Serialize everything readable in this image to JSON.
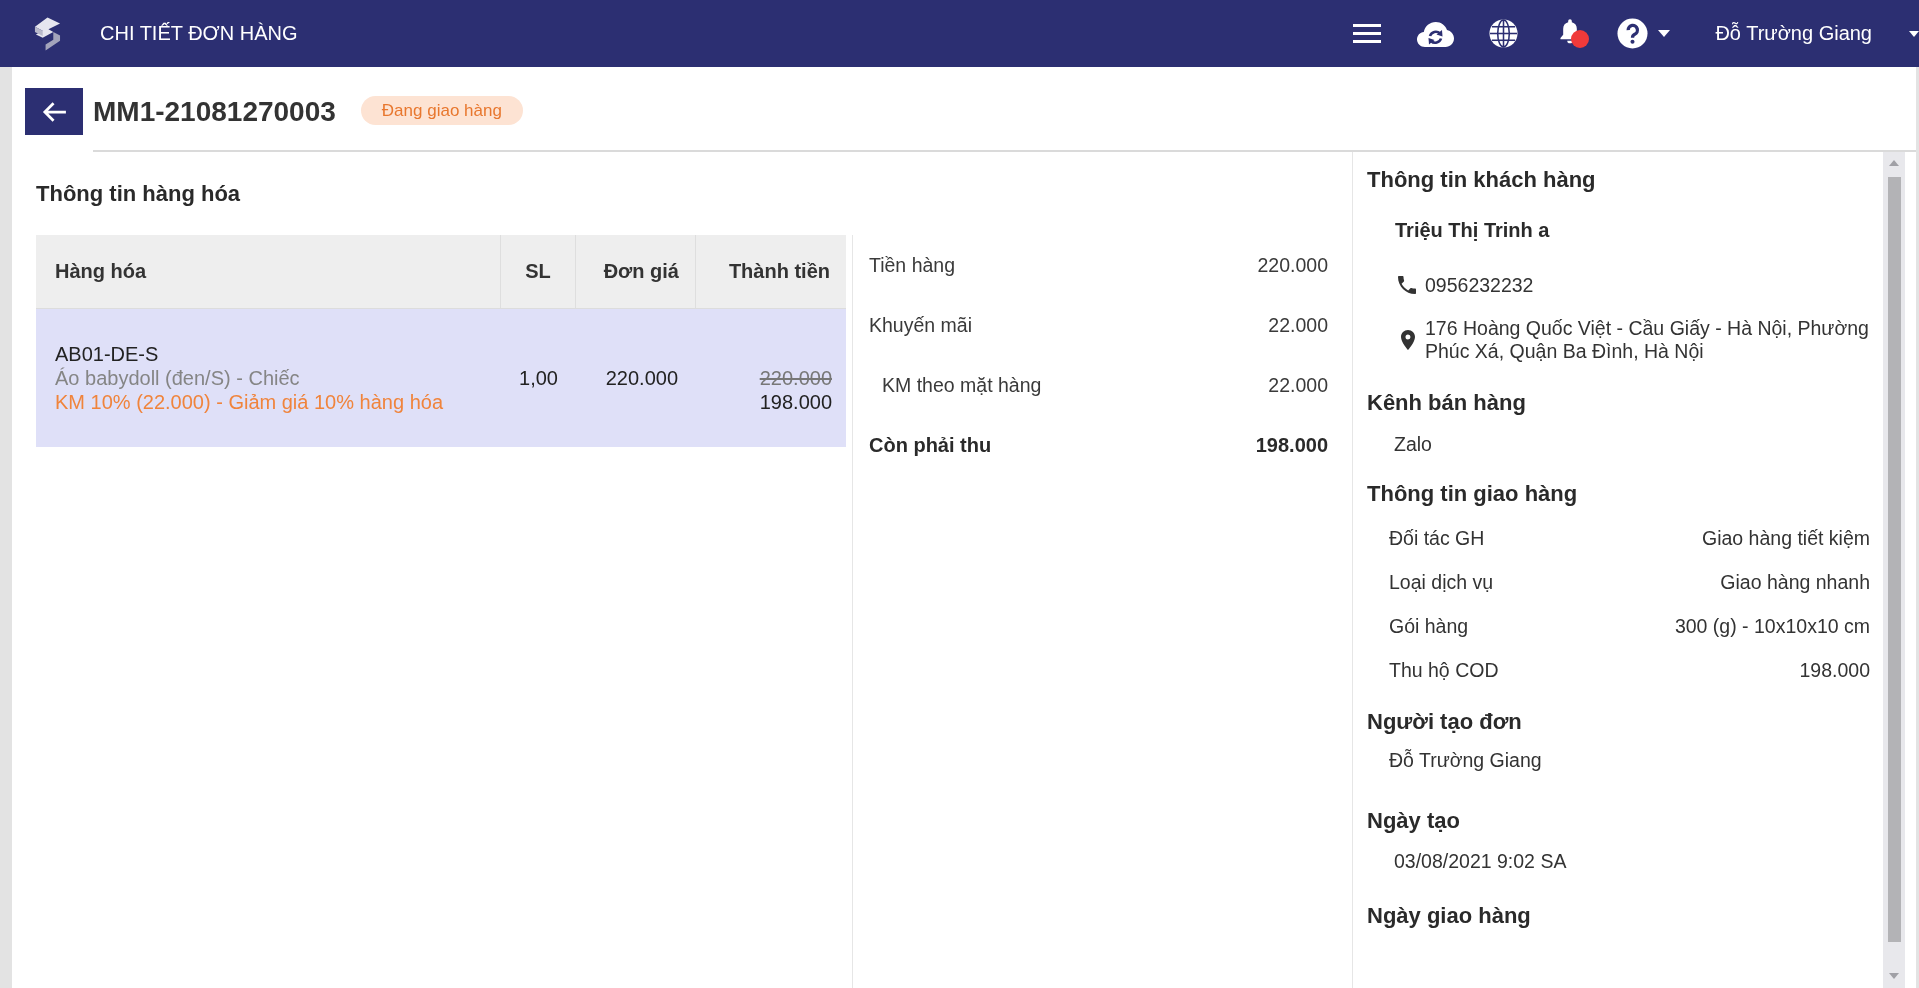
{
  "top_bar": {
    "title": "CHI TIẾT ĐƠN HÀNG",
    "notifications": {
      "unread": true
    },
    "user_name": "Đỗ Trường Giang"
  },
  "order": {
    "code": "MM1-21081270003",
    "status": "Đang giao hàng"
  },
  "goods": {
    "title": "Thông tin hàng hóa",
    "table": {
      "columns": [
        "Hàng hóa",
        "SL",
        "Đơn giá",
        "Thành tiền"
      ],
      "rows": [
        {
          "selected": true,
          "sku": "AB01-DE-S",
          "description": "Áo babydoll (đen/S) - Chiếc",
          "promotion": "KM 10% (22.000) - Giảm giá 10% hàng hóa",
          "quantity": "1,00",
          "unit_price": "220.000",
          "original_total": "220.000",
          "total": "198.000"
        }
      ]
    }
  },
  "summary": [
    {
      "kind": "normal",
      "label": "Tiền hàng",
      "value": "220.000"
    },
    {
      "kind": "normal",
      "label": "Khuyến mãi",
      "value": "22.000"
    },
    {
      "kind": "sub",
      "label": "KM theo mặt hàng",
      "value": "22.000"
    },
    {
      "kind": "total",
      "label": "Còn phải thu",
      "value": "198.000"
    }
  ],
  "customer": {
    "title": "Thông tin khách hàng",
    "name": "Triệu Thị Trinh a",
    "phone": "0956232232",
    "address": "176 Hoàng Quốc Việt - Cầu Giấy - Hà Nội, Phường Phúc Xá, Quận Ba Đình, Hà Nội"
  },
  "sales_channel": {
    "title": "Kênh bán hàng",
    "value": "Zalo"
  },
  "shipping": {
    "title": "Thông tin giao hàng",
    "rows": [
      {
        "label": "Đối tác GH",
        "value": "Giao hàng tiết kiệm"
      },
      {
        "label": "Loại dịch vụ",
        "value": "Giao hàng nhanh"
      },
      {
        "label": "Gói hàng",
        "value": "300 (g) - 10x10x10 cm"
      },
      {
        "label": "Thu hộ COD",
        "value": "198.000"
      }
    ]
  },
  "creator": {
    "title": "Người tạo đơn",
    "value": "Đỗ Trường Giang"
  },
  "created_at": {
    "title": "Ngày tạo",
    "value": "03/08/2021 9:02 SA"
  },
  "delivery_date": {
    "title": "Ngày giao hàng"
  }
}
